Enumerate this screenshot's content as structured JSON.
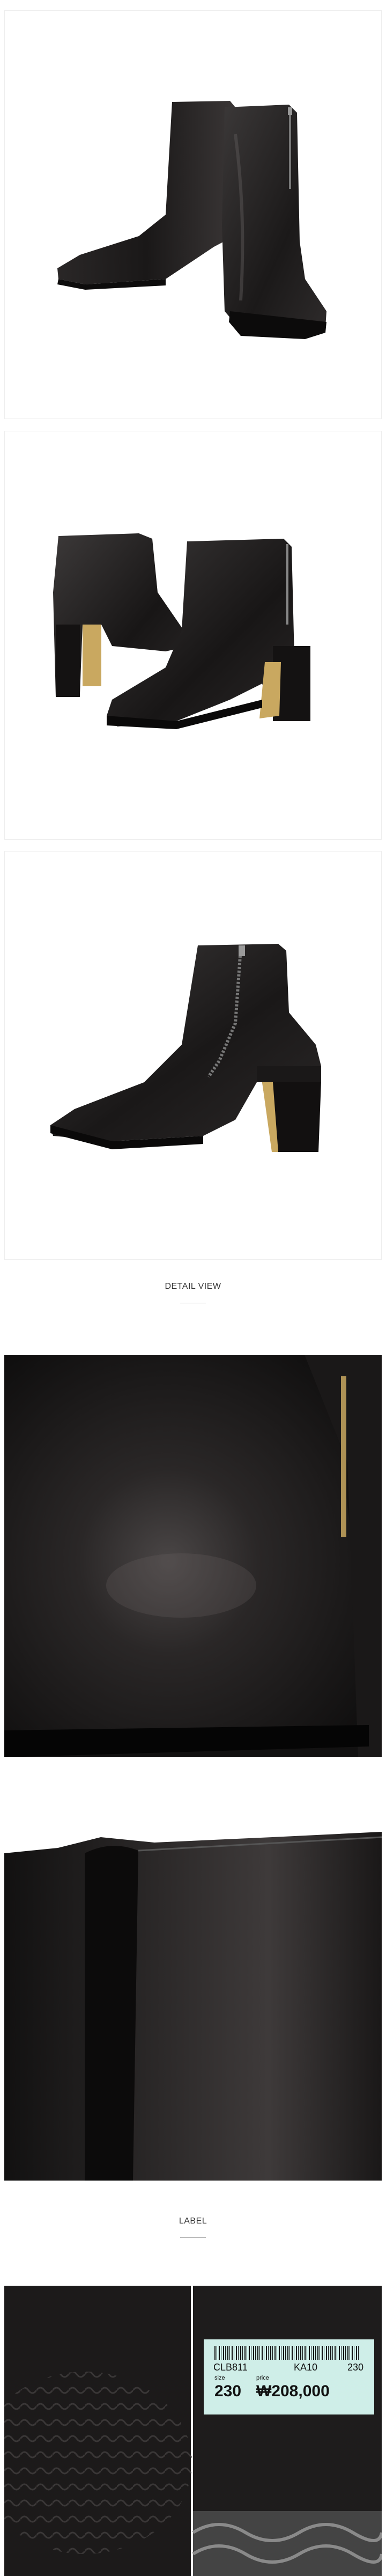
{
  "sections": {
    "detail_view": "DETAIL VIEW",
    "label": "LABEL"
  },
  "price_tag": {
    "code": "CLB811",
    "line": "KA10",
    "size_small": "230",
    "size_label": "size",
    "price_label": "price",
    "size_value": "230",
    "price_value": "₩208,000"
  },
  "colors": {
    "leather": "#1a1818",
    "heel_gold": "#c9a860",
    "tag_bg": "#cfeee8"
  }
}
